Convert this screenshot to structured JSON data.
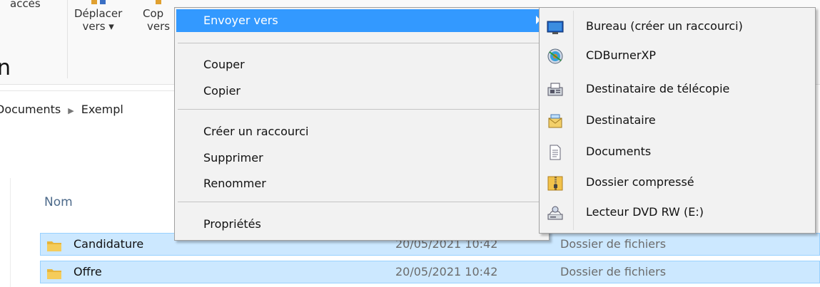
{
  "ribbon": {
    "acces_label": "accès",
    "move_label_1": "Déplacer",
    "move_label_2": "vers ▾",
    "copy_label_1": "Cop",
    "copy_label_2": "vers"
  },
  "page": {
    "partial_text": "n",
    "breadcrumb_1": "Documents",
    "breadcrumb_2": "Exempl"
  },
  "list": {
    "col_name": "Nom",
    "rows": [
      {
        "name": "Candidature",
        "date": "20/05/2021 10:42",
        "type": "Dossier de fichiers"
      },
      {
        "name": "Offre",
        "date": "20/05/2021 10:42",
        "type": "Dossier de fichiers"
      }
    ]
  },
  "context_menu": {
    "send_to": "Envoyer vers",
    "cut": "Couper",
    "copy": "Copier",
    "create_shortcut": "Créer un raccourci",
    "delete": "Supprimer",
    "rename": "Renommer",
    "properties": "Propriétés"
  },
  "submenu": {
    "items": [
      {
        "label": "Bureau (créer un raccourci)",
        "icon": "desktop-icon"
      },
      {
        "label": "CDBurnerXP",
        "icon": "cdburner-icon"
      },
      {
        "label": "Destinataire de télécopie",
        "icon": "fax-icon"
      },
      {
        "label": "Destinataire",
        "icon": "mail-recipient-icon"
      },
      {
        "label": "Documents",
        "icon": "documents-icon"
      },
      {
        "label": "Dossier compressé",
        "icon": "zip-folder-icon"
      },
      {
        "label": "Lecteur DVD RW (E:)",
        "icon": "dvd-drive-icon"
      }
    ]
  },
  "colors": {
    "highlight": "#3399ff",
    "selection": "#cce8ff",
    "menu_bg": "#f2f2f2"
  }
}
